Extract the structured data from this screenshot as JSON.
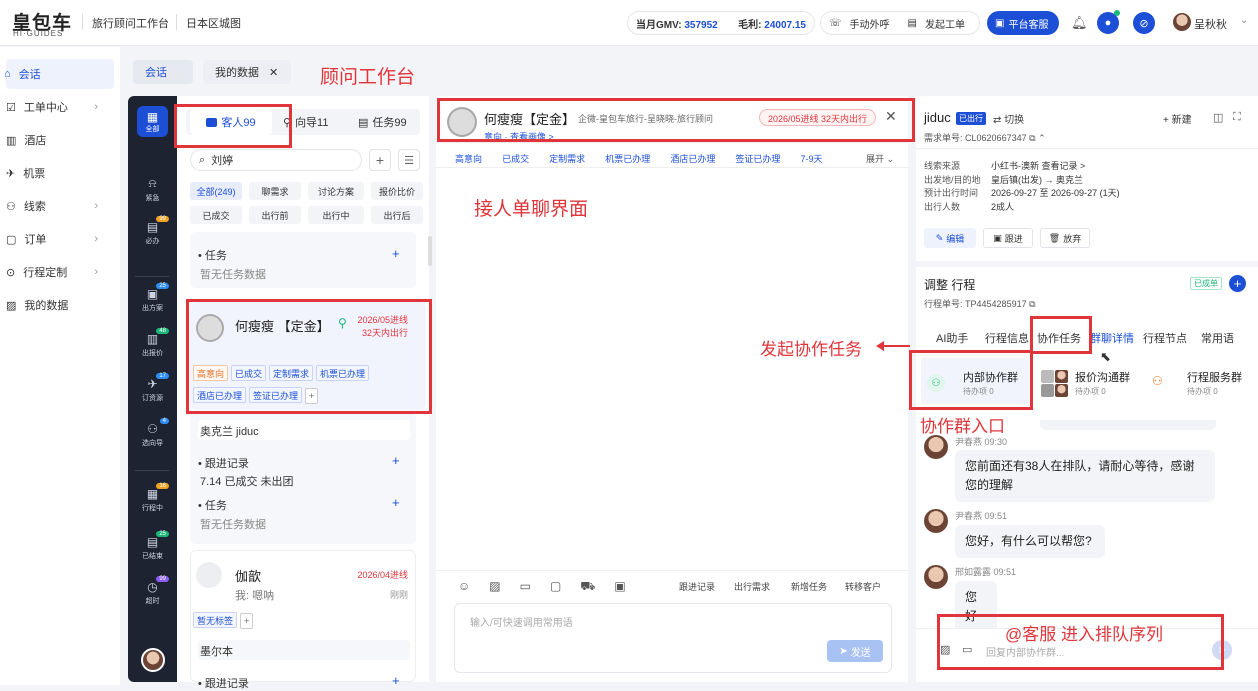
{
  "brand": {
    "title": "皇包车",
    "sub": "HI·GUIDES"
  },
  "top": {
    "workspace": "旅行顾问工作台",
    "map": "日本区城图",
    "gmv_label": "当月GMV:",
    "gmv_value": "357952",
    "profit_label": "毛利:",
    "profit_value": "24007.15",
    "call": "手动外呼",
    "ticket": "发起工单",
    "service": "平台客服",
    "user": "呈秋秋"
  },
  "sidebar": {
    "items": [
      {
        "label": "会话"
      },
      {
        "label": "工单中心"
      },
      {
        "label": "酒店"
      },
      {
        "label": "机票"
      },
      {
        "label": "线索"
      },
      {
        "label": "订单"
      },
      {
        "label": "行程定制"
      },
      {
        "label": "我的数据"
      }
    ]
  },
  "tabs": {
    "items": [
      "会话",
      "我的数据"
    ]
  },
  "iconbar": {
    "items": [
      {
        "label": "全部"
      },
      {
        "label": "紧急"
      },
      {
        "label": "必办",
        "badge": "99"
      },
      {
        "label": "出方案",
        "badge": "25"
      },
      {
        "label": "出报价",
        "badge": "48"
      },
      {
        "label": "订资源",
        "badge": "17"
      },
      {
        "label": "选向导",
        "badge": "4"
      },
      {
        "label": "行程中",
        "badge": "16"
      },
      {
        "label": "已结束",
        "badge": "25"
      },
      {
        "label": "超时",
        "badge": "99"
      }
    ]
  },
  "list": {
    "seg_guest": "客人99",
    "seg_guide": "向导11",
    "seg_task": "任务99",
    "search_value": "刘婷",
    "filters": [
      "全部(249)",
      "聊需求",
      "讨论方案",
      "报价比价",
      "已成交",
      "出行前",
      "出行中",
      "出行后"
    ],
    "prev_card": {
      "task_label": "任务",
      "task_empty": "暂无任务数据"
    },
    "selected": {
      "name": "何瘦瘦 【定金】",
      "status_line1": "2026/05进线",
      "status_line2": "32天内出行",
      "tags": [
        "高意向",
        "已成交",
        "定制需求",
        "机票已办理",
        "酒店已办理",
        "签证已办理"
      ],
      "add": "+"
    },
    "selected_ext": {
      "dest": "奥克兰 jiduc",
      "follow_label": "跟进记录",
      "follow_value": "7.14 已成交 未出团",
      "task_label": "任务",
      "task_empty": "暂无任务数据"
    },
    "next": {
      "name": "伽歆",
      "status": "2026/04进线",
      "preview": "我: 嗯呐",
      "time": "刚刚",
      "tag": "暂无标签",
      "dest": "墨尔本",
      "follow": "跟进记录"
    }
  },
  "chat": {
    "name": "何瘦瘦【定金】",
    "org": "企微-皇包车旅行-呈晓晓-旅行顾问",
    "badge": "2026/05进线 32天内出行",
    "sub": "意向 · 查看画像 >",
    "tags": [
      "高意向",
      "已成交",
      "定制需求",
      "机票已办理",
      "酒店已办理",
      "签证已办理",
      "7-9天"
    ],
    "expand": "展开",
    "toolbar": [
      "跟进记录",
      "出行需求",
      "新增任务",
      "转移客户"
    ],
    "input_placeholder": "输入/可快速调用常用语",
    "send": "发送"
  },
  "right": {
    "title": "jiduc",
    "badge": "已出行",
    "switch": "切换",
    "new": "新建",
    "req_no_label": "需求单号:",
    "req_no": "CL0620667347",
    "fields": [
      {
        "k": "线索来源",
        "v": "小红书-澳新 查看记录 >"
      },
      {
        "k": "出发地/目的地",
        "v": "皇后镇(出发) → 奥克兰"
      },
      {
        "k": "预计出行时间",
        "v": "2026-09-27 至 2026-09-27 (1天)"
      },
      {
        "k": "出行人数",
        "v": "2成人"
      }
    ],
    "actions": [
      "编辑",
      "跟进",
      "放弃"
    ],
    "trip_title": "调整 行程",
    "trip_badge": "已成单",
    "trip_no_label": "行程单号:",
    "trip_no": "TP4454285917",
    "tabs": [
      "AI助手",
      "行程信息",
      "协作任务",
      "群聊详情",
      "行程节点",
      "常用语"
    ],
    "groups": [
      {
        "name": "内部协作群",
        "sub": "待办项 0"
      },
      {
        "name": "报价沟通群",
        "sub": "待办项 0"
      },
      {
        "name": "行程服务群",
        "sub": "待办项 0"
      }
    ],
    "messages": [
      {
        "sender": "尹春燕 09:30",
        "text": "您前面还有38人在排队，请耐心等待，感谢您的理解"
      },
      {
        "sender": "尹春燕 09:51",
        "text": "您好，有什么可以帮您?"
      },
      {
        "sender": "邢如露露 09:51",
        "text": "您好"
      }
    ],
    "input_placeholder": "回复内部协作群..."
  },
  "annotations": {
    "workspace": "顾问工作台",
    "chat": "接人单聊界面",
    "collab": "发起协作任务",
    "group_entry": "协作群入口",
    "queue": "@客服 进入排队序列"
  },
  "colors": {
    "accent": "#1c4fd6",
    "annot": "#e0363b",
    "dark": "#1d2331"
  }
}
